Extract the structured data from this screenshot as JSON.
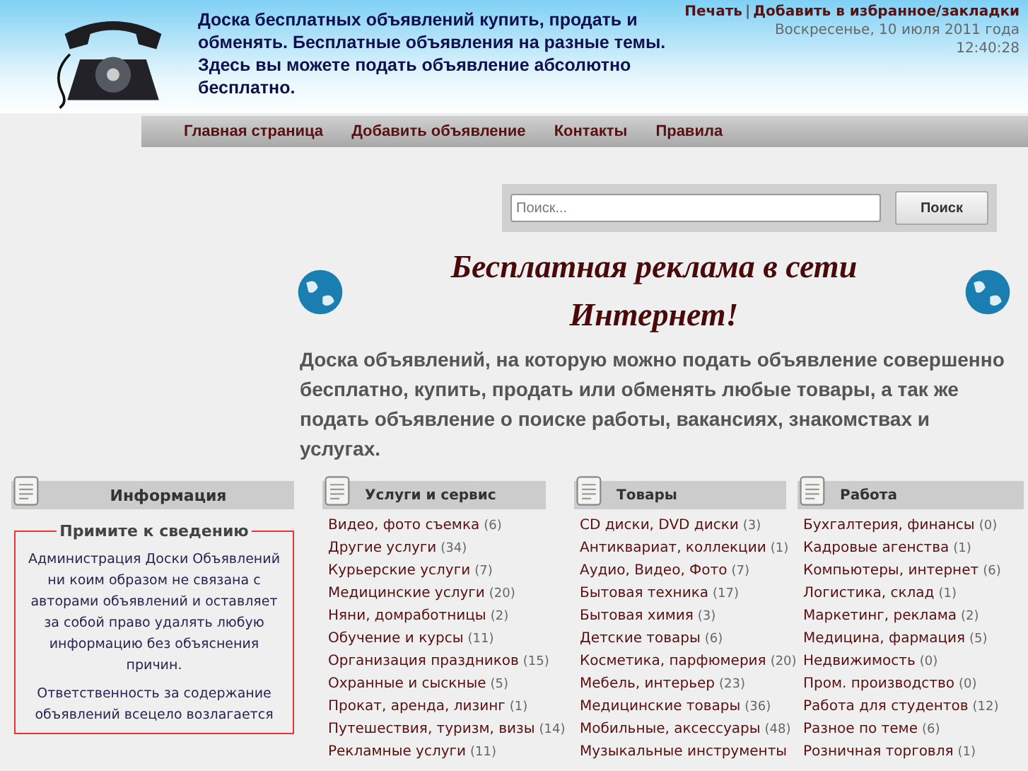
{
  "header": {
    "title": "Доска бесплатных объявлений купить, продать и обменять. Бесплатные объявления на разные темы. Здесь вы можете подать объявление абсолютно бесплатно.",
    "top_links": [
      "Печать",
      "Добавить в избранное/закладки"
    ],
    "link_separator": "|",
    "date": "Воскресенье, 10 июля 2011 года",
    "time": "12:40:28"
  },
  "nav": [
    "Главная страница",
    "Добавить объявление",
    "Контакты",
    "Правила"
  ],
  "search": {
    "placeholder": "Поиск...",
    "button": "Поиск"
  },
  "promo": {
    "heading": "Бесплатная реклама в сети Интернет!",
    "text": "Доска объявлений, на которую можно подать объявление совершенно бесплатно, купить, продать или обменять любые товары, а так же подать объявление о поиске работы, вакансиях, знакомствах и услугах."
  },
  "info": {
    "title": "Информация",
    "notice_title": "Примите к сведению",
    "paragraphs": [
      "Администрация Доски Объявлений ни коим образом не связана с авторами объявлений и оставляет за собой право удалять любую информацию без объяснения причин.",
      "Ответственность за содержание объявлений всецело возлагается"
    ]
  },
  "categories": [
    {
      "title": "Услуги и сервис",
      "items": [
        {
          "name": "Видео, фото съемка",
          "count": "(6)"
        },
        {
          "name": "Другие услуги",
          "count": "(34)"
        },
        {
          "name": "Курьерские услуги",
          "count": "(7)"
        },
        {
          "name": "Медицинские услуги",
          "count": "(20)"
        },
        {
          "name": "Няни, домработницы",
          "count": "(2)"
        },
        {
          "name": "Обучение и курсы",
          "count": "(11)"
        },
        {
          "name": "Организация праздников",
          "count": "(15)"
        },
        {
          "name": "Охранные и сыскные",
          "count": "(5)"
        },
        {
          "name": "Прокат, аренда, лизинг",
          "count": "(1)"
        },
        {
          "name": "Путешествия, туризм, визы",
          "count": "(14)"
        },
        {
          "name": "Рекламные услуги",
          "count": "(11)"
        }
      ]
    },
    {
      "title": "Товары",
      "items": [
        {
          "name": "CD диски, DVD диски",
          "count": "(3)"
        },
        {
          "name": "Антиквариат, коллекции",
          "count": "(1)"
        },
        {
          "name": "Аудио, Видео, Фото",
          "count": "(7)"
        },
        {
          "name": "Бытовая техника",
          "count": "(17)"
        },
        {
          "name": "Бытовая химия",
          "count": "(3)"
        },
        {
          "name": "Детские товары",
          "count": "(6)"
        },
        {
          "name": "Косметика, парфюмерия",
          "count": "(20)"
        },
        {
          "name": "Мебель, интерьер",
          "count": "(23)"
        },
        {
          "name": "Медицинские товары",
          "count": "(36)"
        },
        {
          "name": "Мобильные, аксессуары",
          "count": "(48)"
        },
        {
          "name": "Музыкальные инструменты"
        }
      ]
    },
    {
      "title": "Работа",
      "items": [
        {
          "name": "Бухгалтерия, финансы",
          "count": "(0)"
        },
        {
          "name": "Кадровые агенства",
          "count": "(1)"
        },
        {
          "name": "Компьютеры, интернет",
          "count": "(6)"
        },
        {
          "name": "Логистика, склад",
          "count": "(1)"
        },
        {
          "name": "Маркетинг, реклама",
          "count": "(2)"
        },
        {
          "name": "Медицина, фармация",
          "count": "(5)"
        },
        {
          "name": "Недвижимость",
          "count": "(0)"
        },
        {
          "name": "Пром. производство",
          "count": "(0)"
        },
        {
          "name": "Работа для студентов",
          "count": "(12)"
        },
        {
          "name": "Разное по теме",
          "count": "(6)"
        },
        {
          "name": "Розничная торговля",
          "count": "(1)"
        }
      ]
    }
  ]
}
